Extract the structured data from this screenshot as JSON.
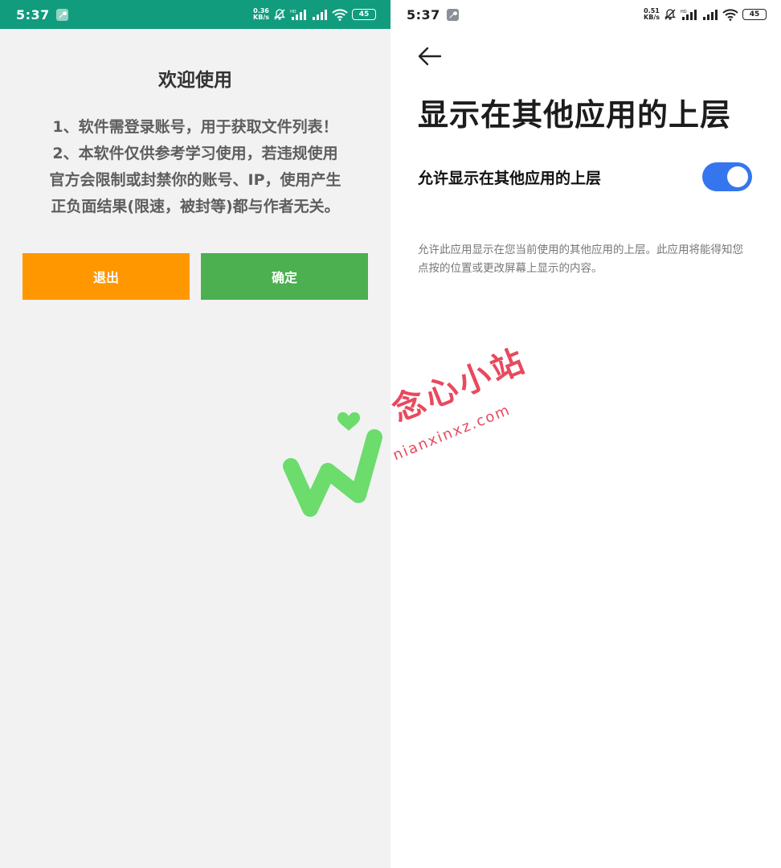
{
  "left_screen": {
    "status_bar": {
      "time": "5:37",
      "speed_value": "0.36",
      "speed_unit": "KB/s",
      "battery": "45",
      "icons": [
        "wrench-icon",
        "mute-icon",
        "signal-icon",
        "hd-signal-icon",
        "wifi-icon",
        "battery-icon"
      ]
    },
    "dialog": {
      "title": "欢迎使用",
      "lines": [
        "1、软件需登录账号，用于获取文件列表！",
        "2、本软件仅供参考学习使用，若违规使用",
        "官方会限制或封禁你的账号、IP，使用产生",
        "正负面结果(限速，被封等)都与作者无关。"
      ],
      "exit_label": "退出",
      "confirm_label": "确定"
    }
  },
  "right_screen": {
    "status_bar": {
      "time": "5:37",
      "speed_value": "0.51",
      "speed_unit": "KB/s",
      "battery": "45"
    },
    "back_icon": "back-arrow-icon",
    "page_title": "显示在其他应用的上层",
    "setting_label": "允许显示在其他应用的上层",
    "toggle_on": true,
    "description": "允许此应用显示在您当前使用的其他应用的上层。此应用将能得知您点按的位置或更改屏幕上显示的内容。"
  },
  "watermark": {
    "brand": "念心小站",
    "url": "nianxinxz.com"
  },
  "colors": {
    "left_status_bar": "#119c7e",
    "exit_button": "#ff9800",
    "confirm_button": "#4caf50",
    "toggle_on": "#3576ee",
    "watermark_red": "#e8495e",
    "watermark_green": "#6cdc6c"
  }
}
